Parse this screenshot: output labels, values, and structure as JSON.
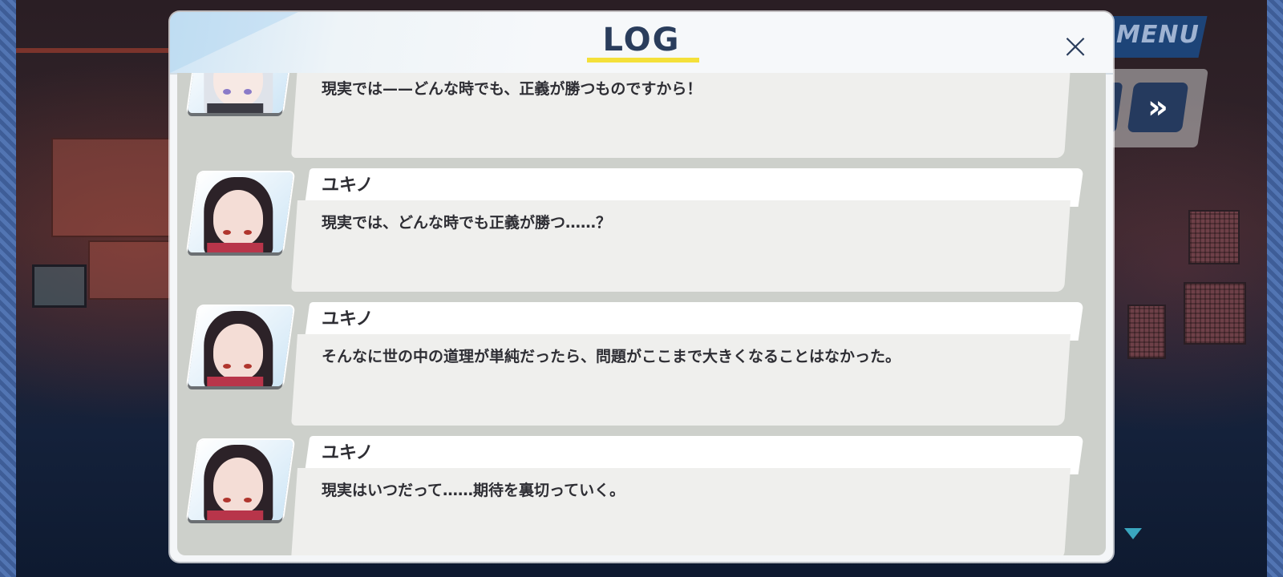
{
  "log": {
    "title": "LOG",
    "close_icon": "×"
  },
  "hud": {
    "menu_label": "MENU",
    "fast_forward_icon": "»"
  },
  "entries": [
    {
      "speaker": "",
      "portrait": "silver-haired-girl",
      "text": "現実では——どんな時でも、正義が勝つものですから！"
    },
    {
      "speaker": "ユキノ",
      "portrait": "yukino",
      "text": "現実では、どんな時でも正義が勝つ……？"
    },
    {
      "speaker": "ユキノ",
      "portrait": "yukino",
      "text": "そんなに世の中の道理が単純だったら、問題がここまで大きくなることはなかった。"
    },
    {
      "speaker": "ユキノ",
      "portrait": "yukino",
      "text": "現実はいつだって……期待を裏切っていく。"
    }
  ],
  "colors": {
    "accent_yellow": "#f4e03a",
    "title_navy": "#2a3d5c",
    "menu_blue": "#1d4478"
  }
}
